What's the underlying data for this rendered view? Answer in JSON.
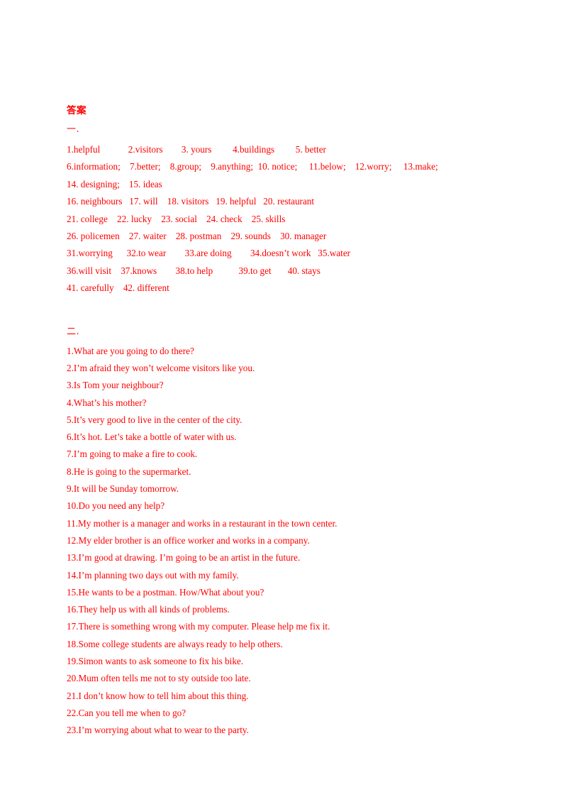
{
  "document": {
    "title": "答案",
    "text_color": "#FF0000",
    "background_color": "#FFFFFF"
  },
  "sections": [
    {
      "label": "一.",
      "type": "answer-key",
      "lines": [
        "1.helpful            2.visitors        3. yours         4.buildings         5. better",
        "6.information;    7.better;    8.group;    9.anything;  10. notice;     11.below;    12.worry;     13.make;",
        "14. designing;    15. ideas",
        "16. neighbours   17. will    18. visitors   19. helpful   20. restaurant",
        "21. college    22. lucky    23. social    24. check    25. skills",
        "26. policemen    27. waiter    28. postman    29. sounds    30. manager",
        "31.worrying      32.to wear        33.are doing        34.doesn’t work   35.water",
        "36.will visit    37.knows        38.to help           39.to get       40. stays",
        "41. carefully    42. different"
      ],
      "answers": [
        {
          "number": "1",
          "answer": "helpful"
        },
        {
          "number": "2",
          "answer": "visitors"
        },
        {
          "number": "3",
          "answer": "yours"
        },
        {
          "number": "4",
          "answer": "buildings"
        },
        {
          "number": "5",
          "answer": "better"
        },
        {
          "number": "6",
          "answer": "information;"
        },
        {
          "number": "7",
          "answer": "better;"
        },
        {
          "number": "8",
          "answer": "group;"
        },
        {
          "number": "9",
          "answer": "anything;"
        },
        {
          "number": "10",
          "answer": "notice;"
        },
        {
          "number": "11",
          "answer": "below;"
        },
        {
          "number": "12",
          "answer": "worry;"
        },
        {
          "number": "13",
          "answer": "make;"
        },
        {
          "number": "14",
          "answer": "designing;"
        },
        {
          "number": "15",
          "answer": "ideas"
        },
        {
          "number": "16",
          "answer": "neighbours"
        },
        {
          "number": "17",
          "answer": "will"
        },
        {
          "number": "18",
          "answer": "visitors"
        },
        {
          "number": "19",
          "answer": "helpful"
        },
        {
          "number": "20",
          "answer": "restaurant"
        },
        {
          "number": "21",
          "answer": "college"
        },
        {
          "number": "22",
          "answer": "lucky"
        },
        {
          "number": "23",
          "answer": "social"
        },
        {
          "number": "24",
          "answer": "check"
        },
        {
          "number": "25",
          "answer": "skills"
        },
        {
          "number": "26",
          "answer": "policemen"
        },
        {
          "number": "27",
          "answer": "waiter"
        },
        {
          "number": "28",
          "answer": "postman"
        },
        {
          "number": "29",
          "answer": "sounds"
        },
        {
          "number": "30",
          "answer": "manager"
        },
        {
          "number": "31",
          "answer": "worrying"
        },
        {
          "number": "32",
          "answer": "to wear"
        },
        {
          "number": "33",
          "answer": "are doing"
        },
        {
          "number": "34",
          "answer": "doesn’t work"
        },
        {
          "number": "35",
          "answer": "water"
        },
        {
          "number": "36",
          "answer": "will visit"
        },
        {
          "number": "37",
          "answer": "knows"
        },
        {
          "number": "38",
          "answer": "to help"
        },
        {
          "number": "39",
          "answer": "to get"
        },
        {
          "number": "40",
          "answer": "stays"
        },
        {
          "number": "41",
          "answer": "carefully"
        },
        {
          "number": "42",
          "answer": "different"
        }
      ]
    },
    {
      "label": "二.",
      "type": "sentence-answers",
      "lines": [
        "1.What are you going to do there?",
        "2.I’m afraid they won’t welcome visitors like you.",
        "3.Is Tom your neighbour?",
        "4.What’s his mother?",
        "5.It’s very good to live in the center of the city.",
        "6.It’s hot. Let’s take a bottle of water with us.",
        "7.I’m going to make a fire to cook.",
        "8.He is going to the supermarket.",
        "9.It will be Sunday tomorrow.",
        "10.Do you need any help?",
        "11.My mother is a manager and works in a restaurant in the town center.",
        "12.My elder brother is an office worker and works in a company.",
        "13.I’m good at drawing. I’m going to be an artist in the future.",
        "14.I’m planning two days out with my family.",
        "15.He wants to be a postman. How/What about you?",
        "16.They help us with all kinds of problems.",
        "17.There is something wrong with my computer. Please help me fix it.",
        "18.Some college students are always ready to help others.",
        "19.Simon wants to ask someone to fix his bike.",
        "20.Mum often tells me not to sty outside too late.",
        "21.I don’t know how to tell him about this thing.",
        "22.Can you tell me when to go?",
        "23.I’m worrying about what to wear to the party."
      ]
    }
  ]
}
